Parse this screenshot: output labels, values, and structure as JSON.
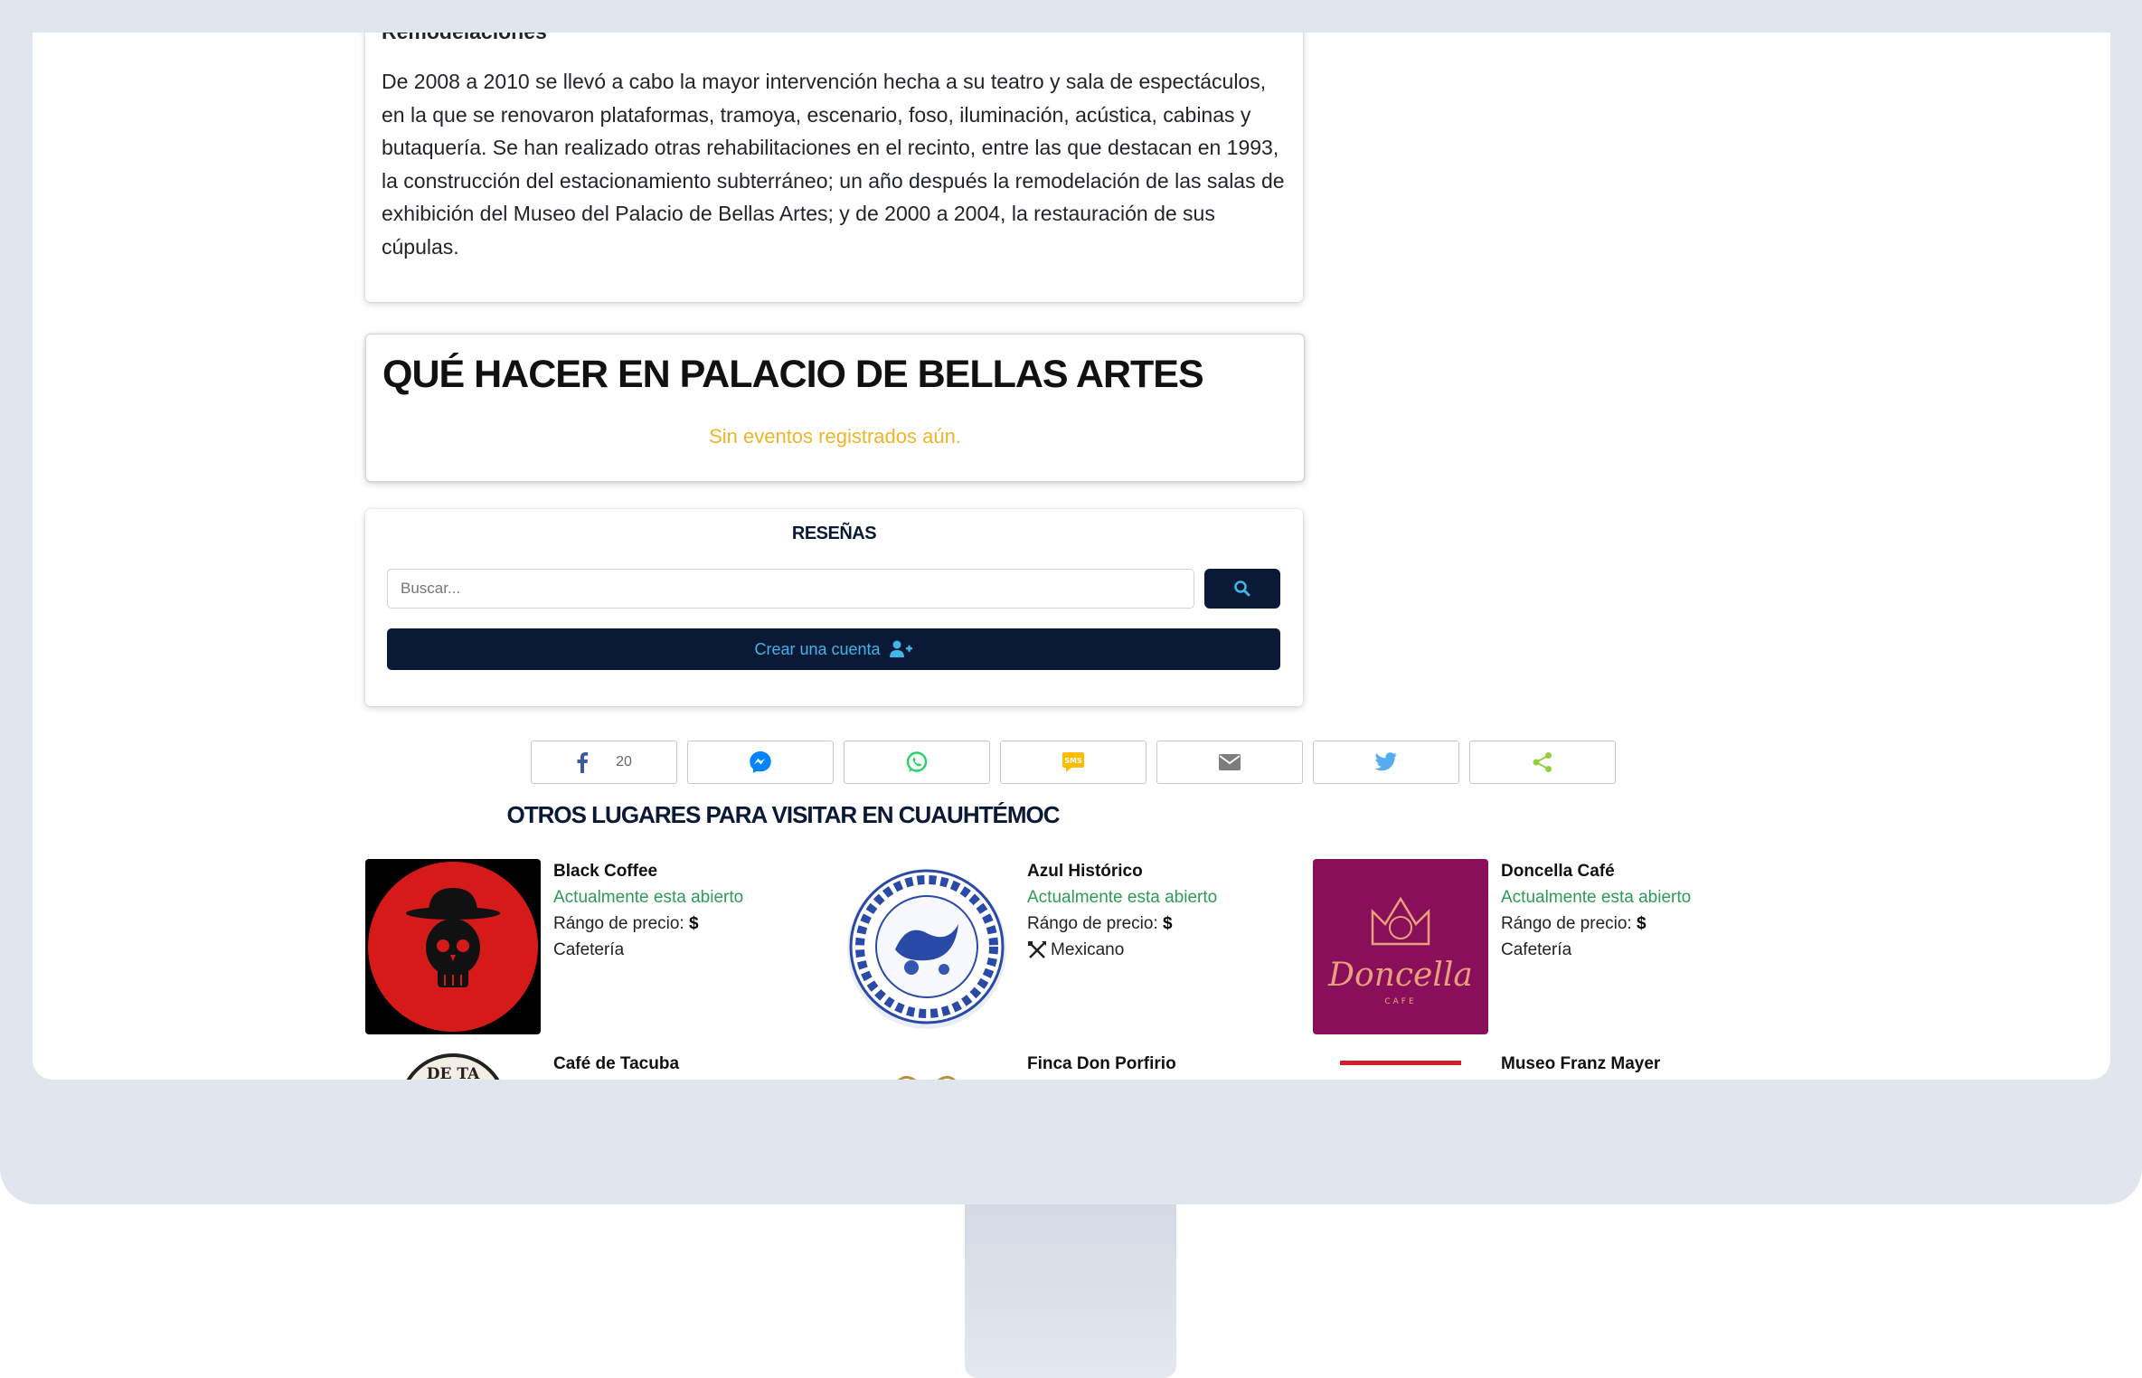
{
  "section_history": {
    "subheading": "Remodelaciones",
    "paragraph": "De 2008 a 2010 se llevó a cabo la mayor intervención hecha a su teatro y sala de espectáculos, en la que se renovaron plataformas, tramoya, escenario, foso, iluminación, acústica, cabinas y butaquería. Se han realizado otras rehabilitaciones en el recinto, entre las que destacan en 1993, la construcción del estacionamiento subterráneo; un año después la remodelación de las salas de exhibición del Museo del Palacio de Bellas Artes; y de 2000 a 2004, la restauración de sus cúpulas."
  },
  "section_events": {
    "title": "QUÉ HACER EN PALACIO DE BELLAS ARTES",
    "empty_message": "Sin eventos registrados aún."
  },
  "reviews": {
    "title": "RESEÑAS",
    "search_placeholder": "Buscar...",
    "create_account_label": "Crear una cuenta"
  },
  "share": {
    "buttons": [
      {
        "network": "facebook",
        "icon": "facebook-icon",
        "count": "20",
        "color": "#3b5998"
      },
      {
        "network": "messenger",
        "icon": "messenger-icon",
        "color": "#0084ff"
      },
      {
        "network": "whatsapp",
        "icon": "whatsapp-icon",
        "color": "#25d366"
      },
      {
        "network": "sms",
        "icon": "sms-icon",
        "color": "#ffbd00"
      },
      {
        "network": "email",
        "icon": "email-icon",
        "color": "#7d7d7d"
      },
      {
        "network": "twitter",
        "icon": "twitter-icon",
        "color": "#55acee"
      },
      {
        "network": "share",
        "icon": "share-icon",
        "color": "#95d03a"
      }
    ]
  },
  "other_places": {
    "title": "OTROS LUGARES PARA VISITAR EN CUAUHTÉMOC",
    "price_label": "Rángo de precio:",
    "items": [
      {
        "name": "Black Coffee",
        "status": "Actualmente esta abierto",
        "price": "$",
        "category": "Cafetería"
      },
      {
        "name": "Azul Histórico",
        "status": "Actualmente esta abierto",
        "price": "$",
        "category": "Mexicano"
      },
      {
        "name": "Doncella Café",
        "status": "Actualmente esta abierto",
        "price": "$",
        "category": "Cafetería",
        "logo_text": "Doncella",
        "logo_sub": "CAFE"
      },
      {
        "name": "Café de Tacuba",
        "logo_text": "DE TA"
      },
      {
        "name": "Finca Don Porfirio"
      },
      {
        "name": "Museo Franz Mayer"
      }
    ]
  },
  "colors": {
    "navy": "#0a1935",
    "accent_blue": "#41b5e8",
    "open_green": "#2e9a57",
    "warning_yellow": "#f0b429",
    "doncella_bg": "#8a0f5b"
  }
}
